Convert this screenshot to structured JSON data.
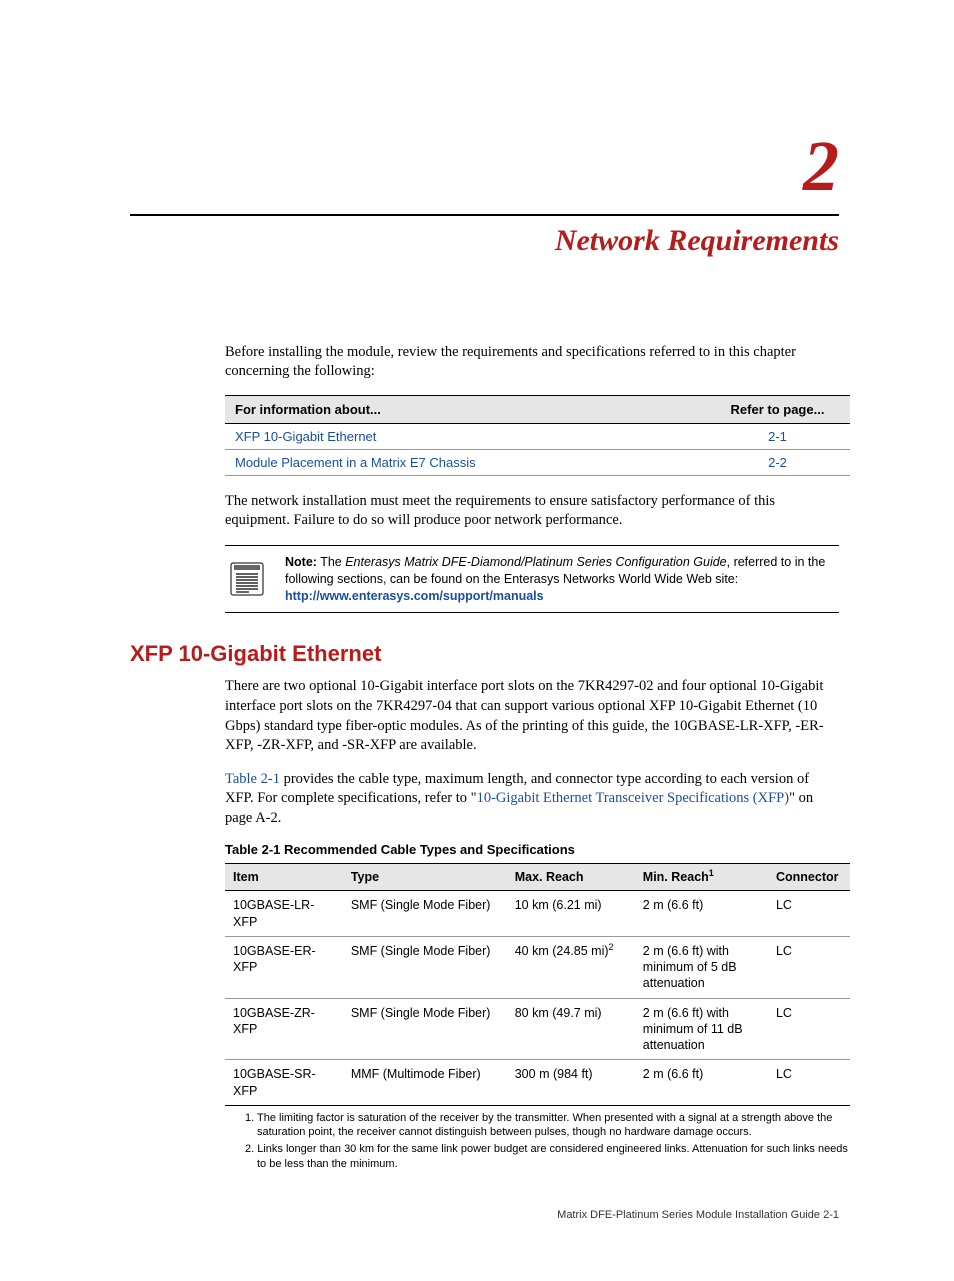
{
  "chapter_number": "2",
  "chapter_title": "Network Requirements",
  "intro_paragraph": "Before installing the module, review the requirements and specifications referred to in this chapter concerning the following:",
  "info_table": {
    "header_info": "For information about...",
    "header_page": "Refer to page...",
    "rows": [
      {
        "label": "XFP 10-Gigabit Ethernet",
        "page": "2-1"
      },
      {
        "label": "Module Placement in a Matrix E7 Chassis",
        "page": "2-2"
      }
    ]
  },
  "after_table_p": "The network installation must meet the requirements to ensure satisfactory performance of this equipment. Failure to do so will produce poor network performance.",
  "note": {
    "label": "Note:",
    "italic_part": "Enterasys Matrix DFE-Diamond/Platinum Series Configuration Guide",
    "pre_italic": " The ",
    "post_italic": ", referred to in the following sections, can be found on the Enterasys Networks World Wide Web site:",
    "url": "http://www.enterasys.com/support/manuals"
  },
  "section_heading": "XFP 10-Gigabit Ethernet",
  "section_p1": "There are two optional 10-Gigabit interface port slots on the 7KR4297-02 and four optional 10-Gigabit interface port slots on the 7KR4297-04 that can support various optional XFP 10-Gigabit Ethernet (10 Gbps) standard type fiber-optic modules. As of the printing of this guide, the 10GBASE-LR-XFP, -ER-XFP, -ZR-XFP, and -SR-XFP are available.",
  "section_p2": {
    "link1": "Table 2-1",
    "mid": " provides the cable type, maximum length, and connector type according to each version of XFP. For complete specifications, refer to \"",
    "link2": "10-Gigabit Ethernet Transceiver Specifications (XFP)",
    "tail": "\" on page A-2."
  },
  "spec_table": {
    "caption": "Table 2-1   Recommended Cable Types and Specifications",
    "headers": {
      "item": "Item",
      "type": "Type",
      "max": "Max. Reach",
      "min_prefix": "Min. Reach",
      "min_sup": "1",
      "connector": "Connector"
    },
    "rows": [
      {
        "item": "10GBASE-LR-XFP",
        "type": "SMF (Single Mode Fiber)",
        "max": "10 km (6.21 mi)",
        "min": "2 m (6.6 ft)",
        "min_sup": "",
        "connector": "LC"
      },
      {
        "item": "10GBASE-ER-XFP",
        "type": "SMF (Single Mode Fiber)",
        "max": "40 km (24.85 mi)",
        "max_sup": "2",
        "min": "2 m (6.6 ft) with minimum of 5 dB attenuation",
        "connector": "LC"
      },
      {
        "item": "10GBASE-ZR-XFP",
        "type": "SMF (Single Mode Fiber)",
        "max": "80 km (49.7 mi)",
        "min": "2 m (6.6 ft) with minimum of 11 dB attenuation",
        "connector": "LC"
      },
      {
        "item": "10GBASE-SR-XFP",
        "type": "MMF (Multimode Fiber)",
        "max": "300 m (984 ft)",
        "min": "2 m (6.6 ft)",
        "connector": "LC"
      }
    ]
  },
  "footnotes": {
    "fn1": "1. The limiting factor is saturation of the receiver by the transmitter. When presented with a signal at a strength above the saturation point, the receiver cannot distinguish between pulses, though no hardware damage occurs.",
    "fn2": "2. Links longer than 30 km for the same link power budget are considered engineered links. Attenuation for such links needs to be less than the minimum."
  },
  "footer": "Matrix DFE-Platinum Series Module Installation Guide    2-1"
}
